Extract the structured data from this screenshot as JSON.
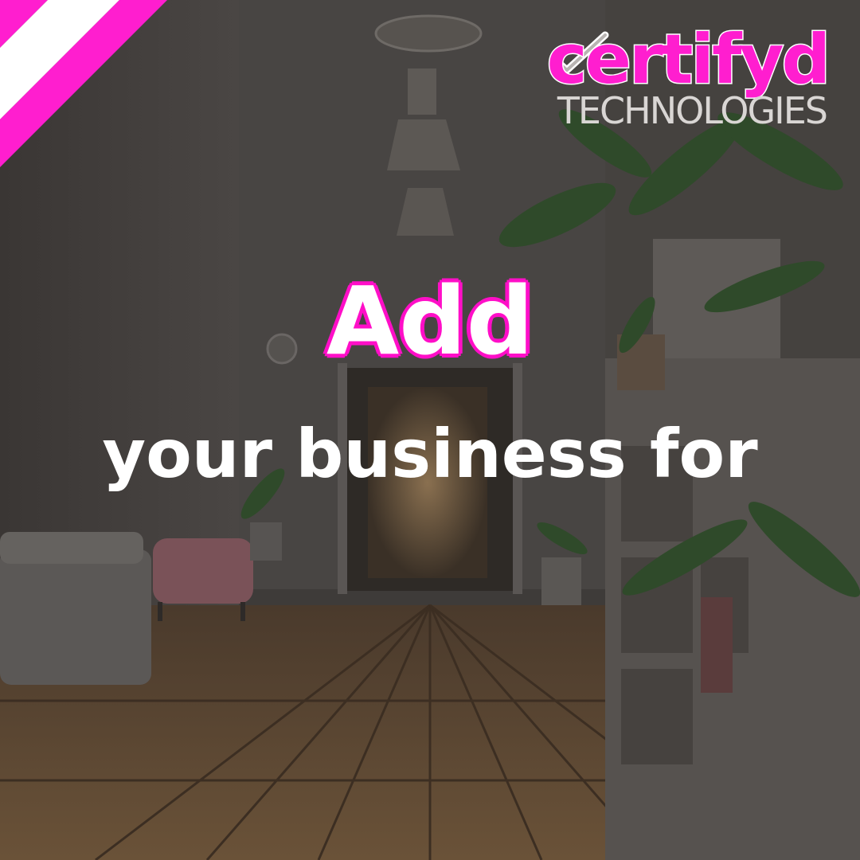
{
  "logo": {
    "brand": "certifyd",
    "tagline": "TECHNOLOGIES",
    "brand_color": "#ff1ecf",
    "check_icon": "checkmark-icon"
  },
  "headline": {
    "main": "Add",
    "sub": "your business for",
    "accent_color": "#ff10c8"
  },
  "ribbon": {
    "colors": [
      "#ff1ecf",
      "#ffffff"
    ]
  },
  "background": {
    "description_icon": "office-interior-image"
  }
}
